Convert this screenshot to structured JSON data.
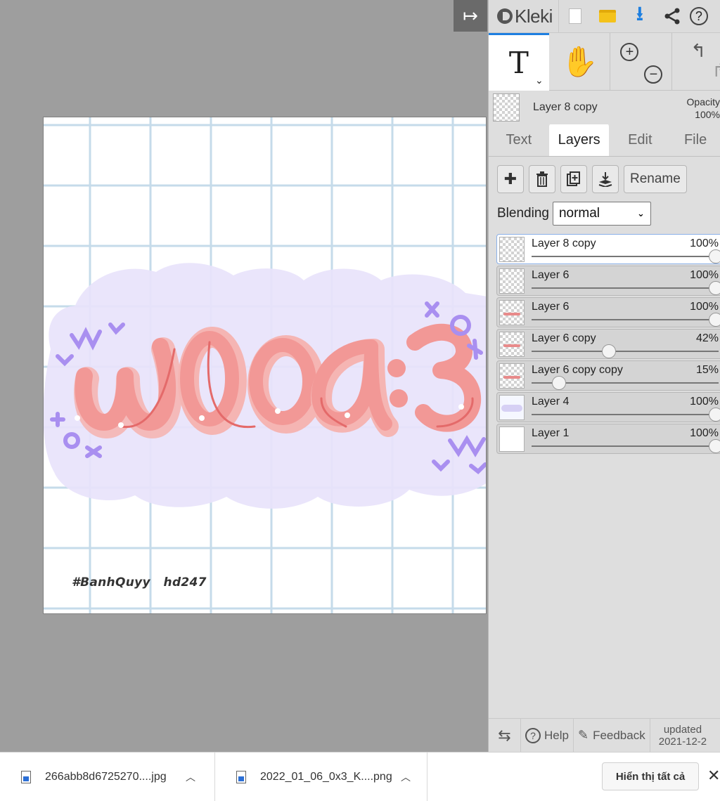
{
  "app": {
    "name": "Kleki"
  },
  "toolbar": {
    "icons": [
      "new-image-icon",
      "open-folder-icon",
      "download-icon",
      "share-icon",
      "help-icon"
    ],
    "help_glyph": "?"
  },
  "tools": {
    "text_glyph": "T",
    "active": "text"
  },
  "current_layer": {
    "name": "Layer 8 copy",
    "opacity_label": "Opacity",
    "opacity_value": "100%"
  },
  "tabs": [
    {
      "label": "Text",
      "active": false
    },
    {
      "label": "Layers",
      "active": true
    },
    {
      "label": "Edit",
      "active": false
    },
    {
      "label": "File",
      "active": false
    }
  ],
  "layer_buttons": {
    "rename": "Rename"
  },
  "blending": {
    "label": "Blending",
    "value": "normal"
  },
  "layers": [
    {
      "name": "Layer 8 copy",
      "opacity": "100%",
      "value": 1.0,
      "selected": true,
      "thumb": "checker"
    },
    {
      "name": "Layer 6",
      "opacity": "100%",
      "value": 1.0,
      "selected": false,
      "thumb": "checker"
    },
    {
      "name": "Layer 6",
      "opacity": "100%",
      "value": 1.0,
      "selected": false,
      "thumb": "checker-pink"
    },
    {
      "name": "Layer 6 copy",
      "opacity": "42%",
      "value": 0.42,
      "selected": false,
      "thumb": "checker-pink"
    },
    {
      "name": "Layer 6 copy copy",
      "opacity": "15%",
      "value": 0.15,
      "selected": false,
      "thumb": "checker-pink"
    },
    {
      "name": "Layer 4",
      "opacity": "100%",
      "value": 1.0,
      "selected": false,
      "thumb": "grid"
    },
    {
      "name": "Layer 1",
      "opacity": "100%",
      "value": 1.0,
      "selected": false,
      "thumb": "white"
    }
  ],
  "canvas": {
    "lettering": "woa:3",
    "watermark": "#BanhQuyy   hd247",
    "colors": {
      "cloud": "#e8e3fb",
      "letters": "#f29896",
      "doodles": "#a98ff0",
      "grid": "#c5dbea"
    }
  },
  "statusbar": {
    "help": "Help",
    "feedback": "Feedback",
    "updated_label": "updated",
    "updated_date": "2021-12-2"
  },
  "downloads": [
    {
      "filename": "266abb8d6725270....jpg"
    },
    {
      "filename": "2022_01_06_0x3_K....png"
    }
  ],
  "downloadbar": {
    "show_all": "Hiển thị tất cả",
    "close_glyph": "✕"
  }
}
